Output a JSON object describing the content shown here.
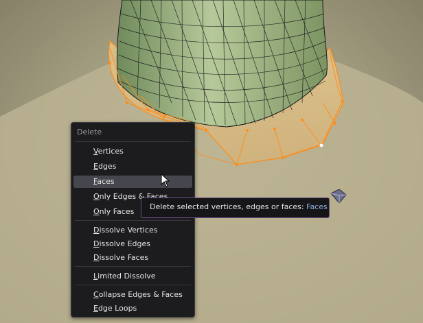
{
  "menu": {
    "title": "Delete",
    "items": [
      {
        "label": "Vertices"
      },
      {
        "label": "Edges"
      },
      {
        "label": "Faces",
        "active": true
      },
      {
        "label": "Only Edges & Faces"
      },
      {
        "label": "Only Faces"
      },
      {
        "label": "Dissolve Vertices"
      },
      {
        "label": "Dissolve Edges"
      },
      {
        "label": "Dissolve Faces"
      },
      {
        "label": "Limited Dissolve"
      },
      {
        "label": "Collapse Edges & Faces"
      },
      {
        "label": "Edge Loops"
      }
    ]
  },
  "tooltip": {
    "text": "Delete selected vertices, edges or faces: ",
    "value": "Faces"
  },
  "colors": {
    "background": "#a39d82",
    "mesh_face": "#8fa37a",
    "selection": "#ff8c1a",
    "menu_bg": "#1c1c1f",
    "tooltip_border": "#6b4c87",
    "tooltip_highlight": "#8db4e8"
  },
  "icons": {
    "cursor": "arrow-cursor-icon",
    "gizmo": "light-gizmo-icon"
  }
}
